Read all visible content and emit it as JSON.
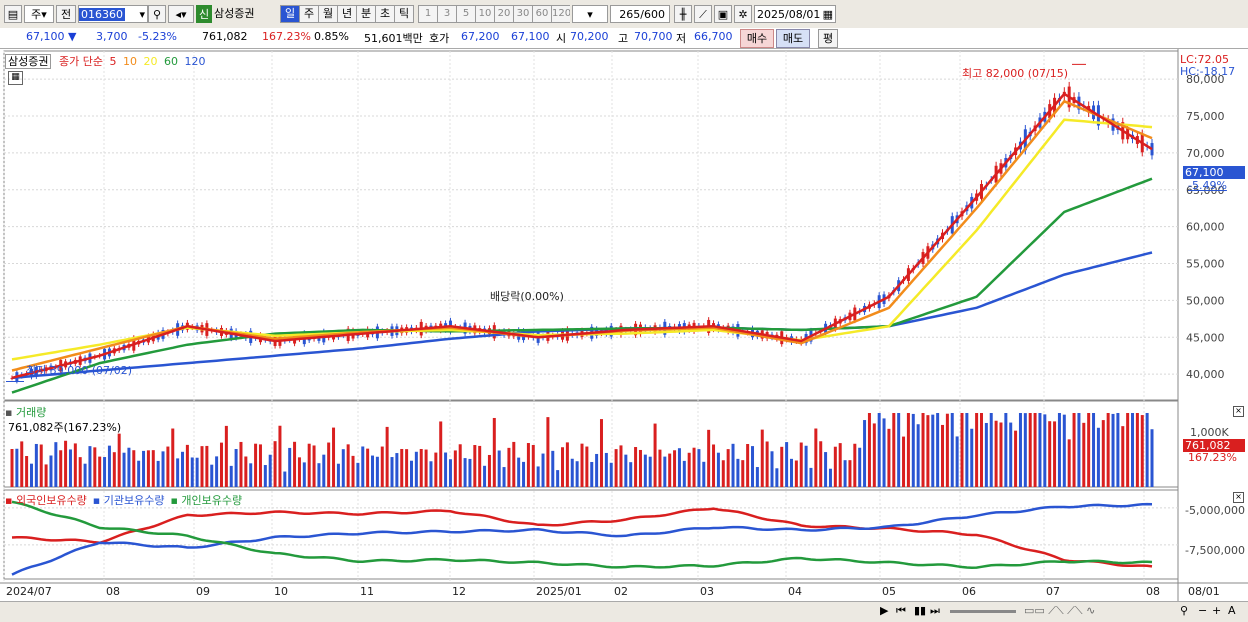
{
  "toolbar": {
    "period_type": "주",
    "prev_label": "전",
    "code": "016360",
    "badge": "신",
    "stock_name": "삼성증권",
    "tabs": [
      "일",
      "주",
      "월",
      "년",
      "분",
      "초",
      "틱"
    ],
    "active_tab": "일",
    "intervals": [
      "1",
      "3",
      "5",
      "10",
      "20",
      "30",
      "60",
      "120"
    ],
    "count_value": "265",
    "count_max": "/600",
    "date": "2025/08/01"
  },
  "quote": {
    "price": "67,100",
    "arrow": "▼",
    "change": "3,700",
    "change_pct": "-5.23%",
    "volume": "761,082",
    "volume_ratio": "167.23%",
    "turnover_pct": "0.85%",
    "amount": "51,601백만",
    "ask_label": "호가",
    "ask1": "67,200",
    "ask2": "67,100",
    "open_label": "시",
    "open": "70,200",
    "high_label": "고",
    "high": "70,700",
    "low_label": "저",
    "low": "66,700",
    "buy_label": "매수",
    "sell_label": "매도",
    "eval_label": "평"
  },
  "price_panel": {
    "stock_label": "삼성증권",
    "ma_label": "종가 단순",
    "ma_periods": [
      "5",
      "10",
      "20",
      "60",
      "120"
    ],
    "ma_colors": [
      "#d91f1f",
      "#f28c1b",
      "#f5ea28",
      "#239a3c",
      "#2a55d2"
    ],
    "lc": "LC:72.05",
    "hc": "HC:-18.17",
    "current_tag": "67,100",
    "current_pct": "-5.49%",
    "high_annotation": "최고 82,000 (07/15)",
    "low_annotation": "최저 39,000 (07/02)",
    "dividend_annotation": "배당락(0.00%)"
  },
  "volume_panel": {
    "title": "거래량",
    "value_label": "761,082주(167.23%)",
    "axis_label": "1,000K",
    "current_tag": "761,082",
    "current_pct": "167.23%"
  },
  "holding_panel": {
    "legend": [
      "외국인보유수량",
      "기관보유수량",
      "개인보유수량"
    ],
    "legend_colors": [
      "#d91f1f",
      "#2a55d2",
      "#239a3c"
    ],
    "y_ticks": [
      "-5,000,000",
      "-7,500,000"
    ]
  },
  "x_axis": [
    "2024/07",
    "08",
    "09",
    "10",
    "11",
    "12",
    "2025/01",
    "02",
    "03",
    "04",
    "05",
    "06",
    "07",
    "08",
    "08/01"
  ],
  "chart_data": [
    {
      "type": "line",
      "title": "삼성증권 일봉 (종가 단순 이동평균)",
      "x": [
        "2024/07",
        "08",
        "09",
        "10",
        "11",
        "12",
        "2025/01",
        "02",
        "03",
        "04",
        "05",
        "06",
        "07",
        "08"
      ],
      "y_ticks": [
        40000,
        45000,
        50000,
        55000,
        60000,
        65000,
        70000,
        75000,
        80000
      ],
      "ylim": [
        36500,
        83000
      ],
      "series": [
        {
          "name": "5",
          "values": [
            39500,
            42500,
            46500,
            44500,
            45500,
            46500,
            45000,
            46000,
            46500,
            44500,
            50500,
            64000,
            78000,
            70500
          ]
        },
        {
          "name": "10",
          "values": [
            40500,
            43500,
            46500,
            44800,
            45700,
            46300,
            45000,
            45900,
            46300,
            44200,
            49000,
            62500,
            77000,
            72000
          ]
        },
        {
          "name": "20",
          "values": [
            42000,
            44000,
            46300,
            45200,
            45700,
            46000,
            45300,
            45500,
            46000,
            44600,
            46500,
            59500,
            74500,
            73500
          ]
        },
        {
          "name": "60",
          "values": [
            37500,
            41500,
            44000,
            45500,
            46000,
            45800,
            46000,
            46200,
            46300,
            46000,
            46500,
            50500,
            62000,
            66500
          ]
        },
        {
          "name": "120",
          "values": [
            39500,
            40500,
            41500,
            42500,
            43500,
            44800,
            45800,
            46200,
            46300,
            46000,
            46500,
            49000,
            53500,
            56500
          ]
        }
      ],
      "high": 82000,
      "low": 39000,
      "last": 67100
    },
    {
      "type": "bar",
      "title": "거래량",
      "last": 761082,
      "last_ratio_pct": 167.23
    },
    {
      "type": "line",
      "title": "보유수량",
      "x": [
        "2024/07",
        "08",
        "09",
        "10",
        "11",
        "12",
        "2025/01",
        "02",
        "03",
        "04",
        "05",
        "06",
        "07",
        "08"
      ],
      "y_ticks": [
        -5000000,
        -7500000
      ],
      "ylim": [
        -9800000,
        -4200000
      ],
      "series": [
        {
          "name": "외국인보유수량",
          "values": [
            -7000000,
            -7300000,
            -5500000,
            -5300000,
            -5400000,
            -5200000,
            -6200000,
            -5800000,
            -5000000,
            -6200000,
            -6400000,
            -6800000,
            -8500000,
            -9000000
          ]
        },
        {
          "name": "기관보유수량",
          "values": [
            -9500000,
            -7300000,
            -7700000,
            -7000000,
            -6700000,
            -6600000,
            -6500000,
            -6900000,
            -6300000,
            -6500000,
            -6300000,
            -5500000,
            -4900000,
            -4800000
          ]
        },
        {
          "name": "개인보유수량",
          "values": [
            -4600000,
            -6300000,
            -6900000,
            -8100000,
            -8600000,
            -8500000,
            -8700000,
            -9000000,
            -8900000,
            -8400000,
            -8700000,
            -9000000,
            -8600000,
            -8700000
          ]
        }
      ]
    }
  ]
}
